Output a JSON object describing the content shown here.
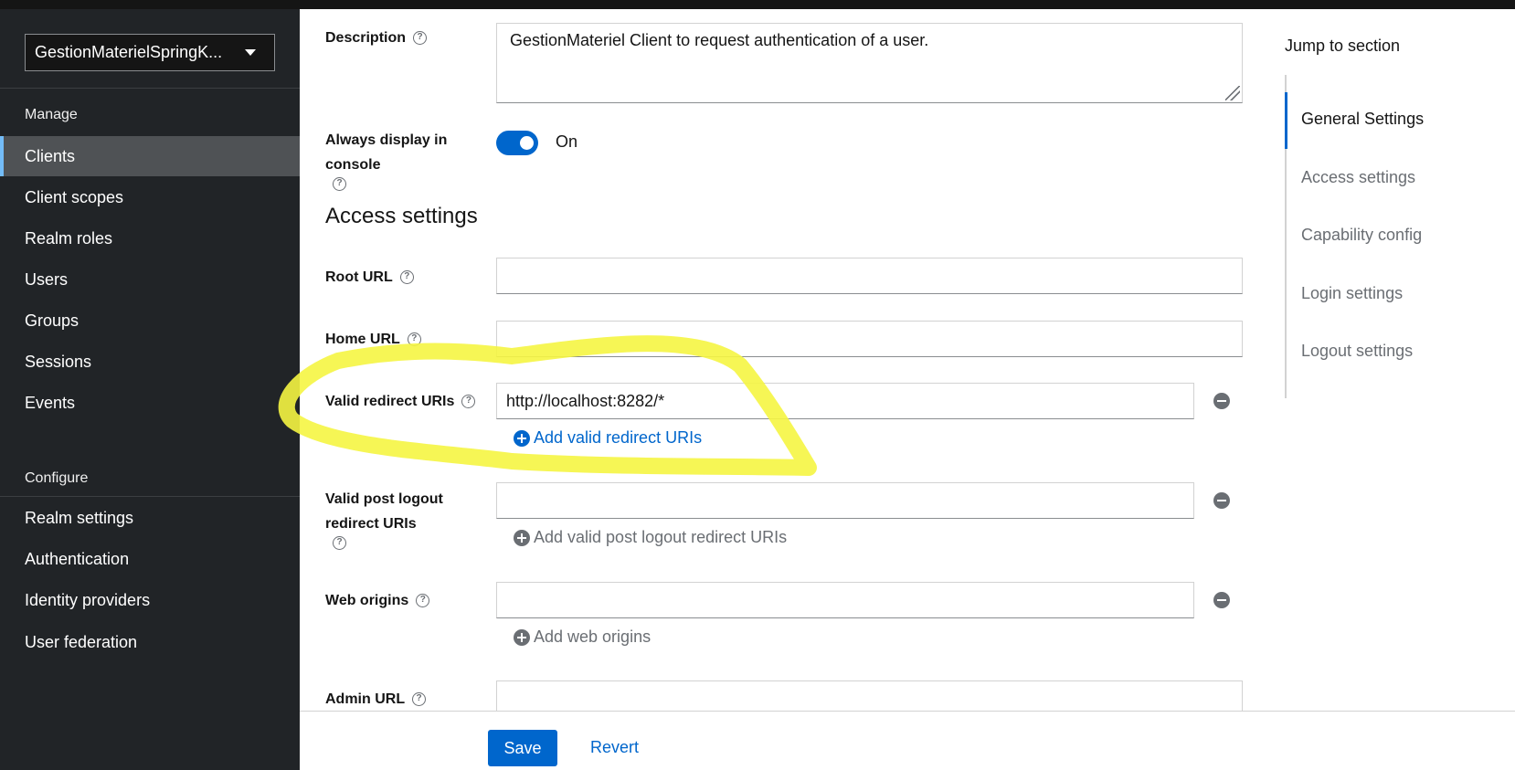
{
  "sidebar": {
    "realm": "GestionMaterielSpringK...",
    "manage_title": "Manage",
    "manage_items": [
      "Clients",
      "Client scopes",
      "Realm roles",
      "Users",
      "Groups",
      "Sessions",
      "Events"
    ],
    "configure_title": "Configure",
    "configure_items": [
      "Realm settings",
      "Authentication",
      "Identity providers",
      "User federation"
    ],
    "active_item": "Clients"
  },
  "form": {
    "description_label": "Description",
    "description_value": "GestionMateriel  Client  to request authentication of a user.",
    "always_display_label": "Always display in console",
    "always_display_state": "On",
    "section_heading": "Access settings",
    "root_url_label": "Root URL",
    "root_url_value": "",
    "home_url_label": "Home URL",
    "home_url_value": "",
    "valid_redirect_label": "Valid redirect URIs",
    "valid_redirect_value": "http://localhost:8282/*",
    "add_valid_redirect": "Add valid redirect URIs",
    "post_logout_label": "Valid post logout redirect URIs",
    "post_logout_value": "",
    "add_post_logout": "Add valid post logout redirect URIs",
    "web_origins_label": "Web origins",
    "web_origins_value": "",
    "add_web_origins": "Add web origins",
    "admin_url_label": "Admin URL"
  },
  "footer": {
    "save": "Save",
    "revert": "Revert"
  },
  "jump": {
    "title": "Jump to section",
    "items": [
      "General Settings",
      "Access settings",
      "Capability config",
      "Login settings",
      "Logout settings"
    ],
    "active": "General Settings"
  },
  "colors": {
    "accent": "#0066cc",
    "highlight": "#f5f542",
    "sidebar_bg": "#212427"
  }
}
